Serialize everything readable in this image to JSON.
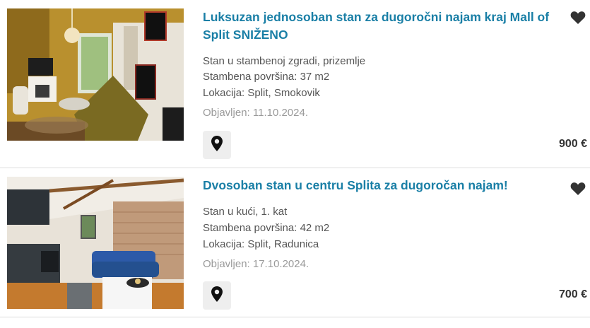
{
  "listings": [
    {
      "title": "Luksuzan jednosoban stan za dugoročni najam kraj Mall of Split SNIŽENO",
      "type": "Stan u stambenoj zgradi, prizemlje",
      "area": "Stambena površina: 37 m2",
      "location": "Lokacija: Split, Smokovik",
      "published": "Objavljen: 11.10.2024.",
      "price": "900 €",
      "icons": {
        "favorite": "heart-icon",
        "map": "map-pin-icon"
      }
    },
    {
      "title": "Dvosoban stan u centru Splita za dugoročan najam!",
      "type": "Stan u kući, 1. kat",
      "area": "Stambena površina: 42 m2",
      "location": "Lokacija: Split, Radunica",
      "published": "Objavljen: 17.10.2024.",
      "price": "700 €",
      "icons": {
        "favorite": "heart-icon",
        "map": "map-pin-icon"
      }
    }
  ],
  "colors": {
    "title_link": "#1a7fa6",
    "text": "#555555",
    "date": "#9a9a9a",
    "price": "#333333",
    "button_bg": "#eeeeee"
  }
}
